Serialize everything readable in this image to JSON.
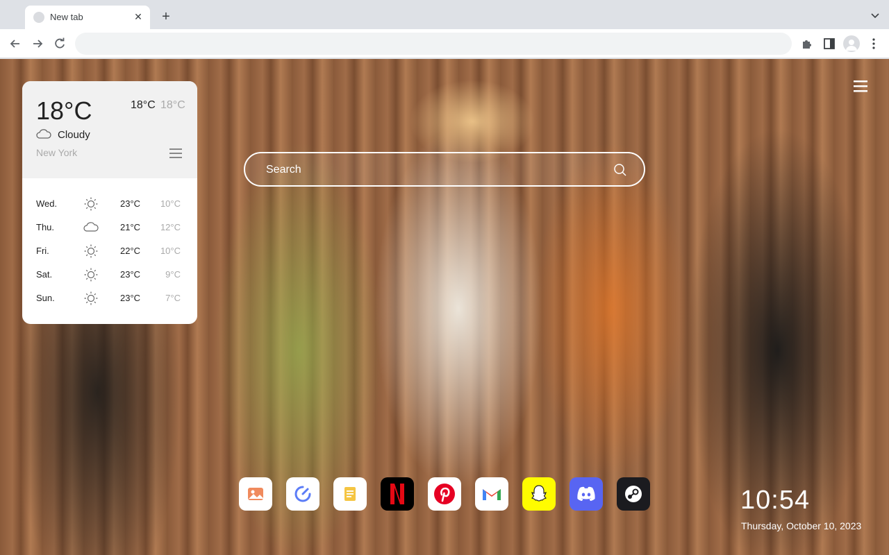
{
  "browser": {
    "tab_title": "New tab",
    "omnibox_value": ""
  },
  "weather": {
    "current_temp": "18°C",
    "high": "18°C",
    "low": "18°C",
    "condition": "Cloudy",
    "condition_icon": "cloud-icon",
    "city": "New York",
    "forecast": [
      {
        "day": "Wed.",
        "icon": "sun-icon",
        "high": "23°C",
        "low": "10°C"
      },
      {
        "day": "Thu.",
        "icon": "cloud-icon",
        "high": "21°C",
        "low": "12°C"
      },
      {
        "day": "Fri.",
        "icon": "sun-icon",
        "high": "22°C",
        "low": "10°C"
      },
      {
        "day": "Sat.",
        "icon": "sun-icon",
        "high": "23°C",
        "low": "9°C"
      },
      {
        "day": "Sun.",
        "icon": "sun-icon",
        "high": "23°C",
        "low": "7°C"
      }
    ]
  },
  "search": {
    "placeholder": "Search"
  },
  "dock": [
    {
      "name": "gallery-app",
      "icon": "image-icon",
      "bg": "#ffffff"
    },
    {
      "name": "speedtest-app",
      "icon": "gauge-icon",
      "bg": "#ffffff"
    },
    {
      "name": "notes-app",
      "icon": "note-icon",
      "bg": "#ffffff"
    },
    {
      "name": "netflix-app",
      "icon": "netflix-icon",
      "bg": "#000000"
    },
    {
      "name": "pinterest-app",
      "icon": "pinterest-icon",
      "bg": "#ffffff"
    },
    {
      "name": "gmail-app",
      "icon": "gmail-icon",
      "bg": "#ffffff"
    },
    {
      "name": "snapchat-app",
      "icon": "snapchat-icon",
      "bg": "#fffc00"
    },
    {
      "name": "discord-app",
      "icon": "discord-icon",
      "bg": "#5865f2"
    },
    {
      "name": "steam-app",
      "icon": "steam-icon",
      "bg": "#1b1b1f"
    }
  ],
  "clock": {
    "time": "10:54",
    "date": "Thursday, October 10, 2023"
  }
}
